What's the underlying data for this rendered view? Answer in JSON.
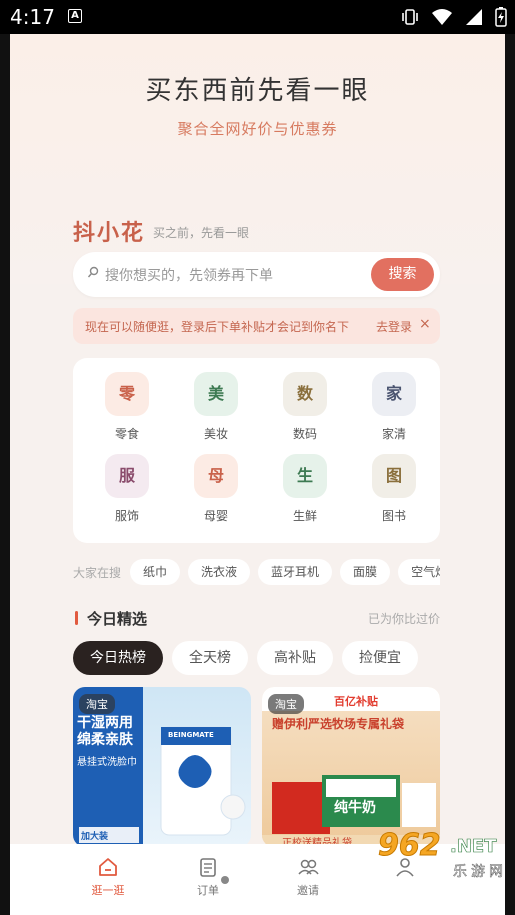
{
  "status_bar": {
    "time": "4:17",
    "app_badge": "A",
    "icons": [
      "vibrate-icon",
      "wifi-icon",
      "signal-icon",
      "battery-charging-icon"
    ]
  },
  "hero": {
    "title": "买东西前先看一眼",
    "subtitle": "聚合全网好价与优惠券"
  },
  "brand": {
    "name": "抖小花",
    "tagline": "买之前，先看一眼"
  },
  "search": {
    "placeholder": "搜你想买的，先领券再下单",
    "button": "搜索"
  },
  "notice": {
    "text": "现在可以随便逛，登录后下单补贴才会记到你名下",
    "action": "去登录",
    "close": "×"
  },
  "categories": [
    {
      "icon_text": "零",
      "label": "零食",
      "bg": "#fcebe4",
      "fg": "#c9614a"
    },
    {
      "icon_text": "美",
      "label": "美妆",
      "bg": "#e6f2ea",
      "fg": "#3d7a52"
    },
    {
      "icon_text": "数",
      "label": "数码",
      "bg": "#f1eee7",
      "fg": "#8a6f3c"
    },
    {
      "icon_text": "家",
      "label": "家清",
      "bg": "#eceef3",
      "fg": "#4a5470"
    },
    {
      "icon_text": "服",
      "label": "服饰",
      "bg": "#f4eaf0",
      "fg": "#8a4c6c"
    },
    {
      "icon_text": "母",
      "label": "母婴",
      "bg": "#fcebe4",
      "fg": "#c9614a"
    },
    {
      "icon_text": "生",
      "label": "生鲜",
      "bg": "#e6f2ea",
      "fg": "#3d7a52"
    },
    {
      "icon_text": "图",
      "label": "图书",
      "bg": "#f1eee7",
      "fg": "#8a6f3c"
    }
  ],
  "hot_search": {
    "label": "大家在搜",
    "chips": [
      "纸巾",
      "洗衣液",
      "蓝牙耳机",
      "面膜",
      "空气炸"
    ]
  },
  "section": {
    "title": "今日精选",
    "note": "已为你比过价"
  },
  "tabs": [
    {
      "label": "今日热榜",
      "active": true
    },
    {
      "label": "全天榜",
      "active": false
    },
    {
      "label": "高补贴",
      "active": false
    },
    {
      "label": "捡便宜",
      "active": false
    }
  ],
  "products": [
    {
      "source": "淘宝",
      "headline1": "干湿两用",
      "headline2": "绵柔亲肤",
      "headline3": "悬挂式洗脸巾",
      "brand": "BEINGMATE",
      "badge": "加大装"
    },
    {
      "source": "淘宝",
      "campaign": "百亿补贴",
      "headline": "赠伊利严选牧场专属礼袋",
      "product": "纯牛奶",
      "footer": "正校送精品礼袋"
    }
  ],
  "bottom_nav": [
    {
      "label": "逛一逛",
      "icon": "home-icon",
      "active": true
    },
    {
      "label": "订单",
      "icon": "order-icon",
      "active": false
    },
    {
      "label": "邀请",
      "icon": "invite-icon",
      "active": false
    },
    {
      "label": "",
      "icon": "profile-icon",
      "active": false
    }
  ],
  "watermark": {
    "num": "962",
    "net": ".NET",
    "cn": "乐游网"
  },
  "colors": {
    "accent": "#e27060",
    "brand": "#c8614b",
    "background": "#f7f1ee"
  }
}
